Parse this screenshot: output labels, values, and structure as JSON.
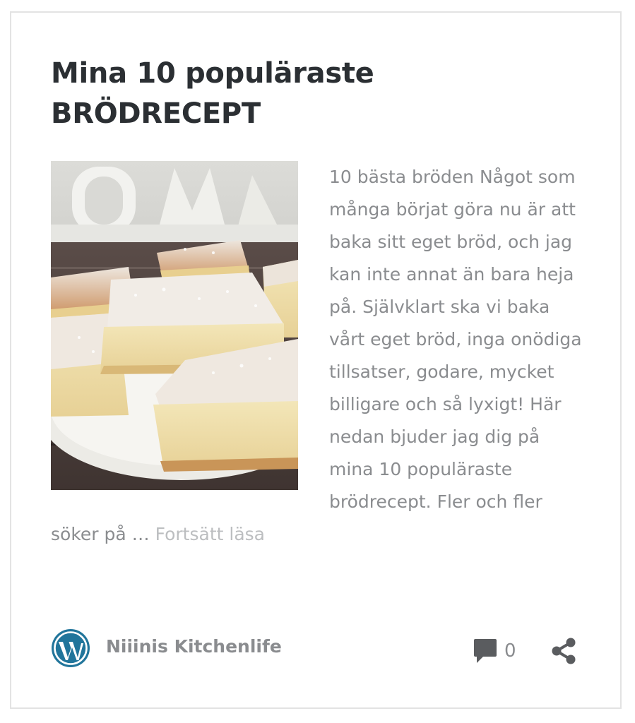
{
  "post": {
    "title_line1": "Mina 10 populäraste",
    "title_line2": "BRÖDRECEPT",
    "excerpt": "10 bästa bröden Något som många börjat göra nu är att baka sitt eget bröd, och jag kan inte annat än bara heja på. Självklart ska vi baka vårt eget bröd, inga onödiga tillsatser, godare, mycket billigare och så lyxigt! Här nedan bjuder jag dig på mina 10 populäraste brödrecept. Fler och fler söker på … ",
    "read_more": "Fortsätt läsa",
    "thumbnail_icon": "bread-photo",
    "site_logo_icon": "wordpress-logo-icon",
    "author": "Niiinis Kitchenlife",
    "comment_icon": "comment-icon",
    "comment_count": "0",
    "share_icon": "share-icon"
  },
  "colors": {
    "title": "#2b2f33",
    "text": "#8a8c8f",
    "link": "#bcbec0",
    "wordpress_blue": "#21759b",
    "card_border": "#e3e3e3"
  }
}
